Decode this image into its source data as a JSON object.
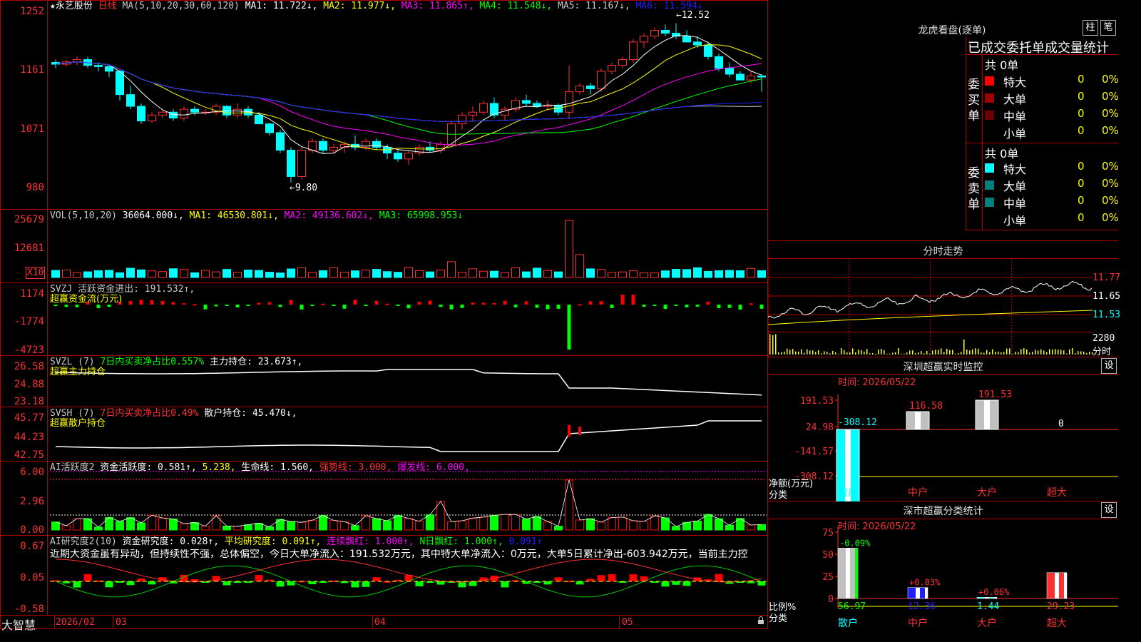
{
  "stock": {
    "star": "★",
    "name": "永艺股份",
    "period": "日线"
  },
  "ma_header": [
    {
      "text": "MA(5,10,20,30,60,120)",
      "color": "#c8c8c8"
    },
    {
      "text": "MA1: 11.722↓,",
      "color": "#ffffff"
    },
    {
      "text": "MA2: 11.977↓,",
      "color": "#ffff00"
    },
    {
      "text": "MA3: 11.865↑,",
      "color": "#ff00ff"
    },
    {
      "text": "MA4: 11.548↓,",
      "color": "#00ff00"
    },
    {
      "text": "MA5: 11.167↓,",
      "color": "#c8c8c8"
    },
    {
      "text": "MA6: 11.594↓",
      "color": "#2020ff"
    }
  ],
  "price_axis": [
    "1252",
    "1161",
    "1071",
    "980"
  ],
  "price_marks": {
    "high": "12.52",
    "low": "9.80"
  },
  "vol_header": [
    {
      "text": "VOL(5,10,20)",
      "color": "#c8c8c8"
    },
    {
      "text": "36064.000↓,",
      "color": "#ffffff"
    },
    {
      "text": "MA1: 46530.801↓,",
      "color": "#ffff00"
    },
    {
      "text": "MA2: 49136.602↓,",
      "color": "#ff00ff"
    },
    {
      "text": "MA3: 65998.953↓",
      "color": "#00ff00"
    }
  ],
  "vol_axis": [
    "25679",
    "12681"
  ],
  "vol_unit": "X10",
  "svzj": {
    "line1": [
      {
        "text": "SVZJ  活跃资金进出: 191.532↑,",
        "color": "#c8c8c8"
      }
    ],
    "line2": "超赢资金流(万元)",
    "axis": [
      "1174",
      "-1774",
      "-4723"
    ]
  },
  "svzl": {
    "line1": [
      {
        "text": "SVZL (7)",
        "color": "#c8c8c8"
      },
      {
        "text": "7日内买卖净占比0.557%",
        "color": "#00ff00"
      },
      {
        "text": "主力持仓: 23.673↑,",
        "color": "#ffffff"
      }
    ],
    "line2": "超赢主力持仓",
    "axis": [
      "26.58",
      "24.88",
      "23.18"
    ]
  },
  "svsh": {
    "line1": [
      {
        "text": "SVSH (7)",
        "color": "#c8c8c8"
      },
      {
        "text": "7日内买卖净占比0.49%",
        "color": "#ff3030"
      },
      {
        "text": "散户持仓: 45.470↓,",
        "color": "#ffffff"
      }
    ],
    "line2": "超赢散户持仓",
    "axis": [
      "45.77",
      "44.23",
      "42.75"
    ]
  },
  "ai_active": {
    "line1": [
      {
        "text": "AI活跃度2",
        "color": "#c8c8c8"
      },
      {
        "text": "资金活跃度: 0.581↑,",
        "color": "#ffffff"
      },
      {
        "text": "5.238,",
        "color": "#ffff00"
      },
      {
        "text": "生命线: 1.560,",
        "color": "#ffffff"
      },
      {
        "text": "强势线: 3.000,",
        "color": "#ff3030"
      },
      {
        "text": "爆发线: 6.000,",
        "color": "#ff00ff"
      }
    ],
    "axis": [
      "6.00",
      "2.96",
      "0.00"
    ]
  },
  "ai_research": {
    "line1": [
      {
        "text": "AI研究度2(10)",
        "color": "#c8c8c8"
      },
      {
        "text": "资金研究度: 0.028↑,",
        "color": "#ffffff"
      },
      {
        "text": "平均研究度: 0.091↑,",
        "color": "#ffff00"
      },
      {
        "text": "连续飘红: 1.000↑,",
        "color": "#ff00ff"
      },
      {
        "text": "N日飘红: 1.000↑,",
        "color": "#00ff00"
      },
      {
        "text": "0.091↑",
        "color": "#2020ff"
      }
    ],
    "summary": "近期大资金虽有异动，但持续性不强，总体偏空，今日大单净流入：191.532万元，其中特大单净流入：0万元，大单5日累计净出-603.942万元，当前主力控",
    "axis": [
      "0.67",
      "0.05",
      "-0.58"
    ]
  },
  "bottom": {
    "brand": "大智慧",
    "dates": [
      "2026/02",
      "03",
      "04",
      "05"
    ]
  },
  "colors": {
    "up": "#ff3030",
    "down": "#00ffff",
    "red": "#ff0000",
    "green": "#00ff00",
    "frame": "#b00000"
  },
  "right": {
    "lhb_title": "龙虎看盘(逐单)",
    "btn_bar": "柱",
    "btn_pen": "笔",
    "stat_title": "已成交委托单成交量统计",
    "buy_label": "委买单",
    "sell_label": "委卖单",
    "buy_total": "共 0单",
    "sell_total": "共 0单",
    "buy_rows": [
      {
        "label": "特大",
        "qty": "0",
        "pct": "0%",
        "color": "#ff0000"
      },
      {
        "label": "大单",
        "qty": "0",
        "pct": "0%",
        "color": "#a00000"
      },
      {
        "label": "中单",
        "qty": "0",
        "pct": "0%",
        "color": "#700000"
      },
      {
        "label": "小单",
        "qty": "0",
        "pct": "0%",
        "color": "#000000"
      }
    ],
    "sell_rows": [
      {
        "label": "特大",
        "qty": "0",
        "pct": "0%",
        "color": "#00ffff"
      },
      {
        "label": "大单",
        "qty": "0",
        "pct": "0%",
        "color": "#008080"
      },
      {
        "label": "中单",
        "qty": "0",
        "pct": "0%",
        "color": "#008080"
      },
      {
        "label": "小单",
        "qty": "0",
        "pct": "0%",
        "color": "#000000"
      }
    ],
    "fenshi_title": "分时走势",
    "fenshi_axis": [
      "11.77",
      "11.65",
      "11.53"
    ],
    "fenshi_vol_label": "2280",
    "fenshi_vol_unit": "分时",
    "sz_monitor_title": "深圳超赢实时监控",
    "sz_monitor_btn": "设",
    "sz_monitor_time": "时间: 2026/05/22",
    "monitor_axis": [
      "191.53",
      "24.98",
      "-141.57",
      "-308.12"
    ],
    "monitor_ylabel": "净额(万元)",
    "monitor_xlabel": "分类",
    "monitor_cats": [
      "散户",
      "中户",
      "大户",
      "超大"
    ],
    "monitor_values": [
      "-308.12",
      "116.58",
      "191.53",
      "0"
    ],
    "sz_class_title": "深市超赢分类统计",
    "sz_class_btn": "设",
    "sz_class_time": "时间: 2026/05/22",
    "class_axis": [
      "75",
      "50",
      "25",
      "0"
    ],
    "class_ylabel": "比例%",
    "class_xlabel": "分类",
    "class_cats": [
      "散户",
      "中户",
      "大户",
      "超大"
    ],
    "class_deltas": [
      "-0.09%",
      "+0.03%",
      "+0.06%"
    ],
    "class_values": [
      "56.97",
      "12.36",
      "1.44",
      "29.23"
    ]
  },
  "chart_data": [
    {
      "type": "candlestick",
      "title": "永艺股份 日线",
      "ylim": [
        9.6,
        12.65
      ],
      "x": [
        "2026/02",
        "03",
        "04",
        "05"
      ],
      "ohlc": [
        [
          11.85,
          11.9,
          11.75,
          11.82
        ],
        [
          11.82,
          11.9,
          11.78,
          11.86
        ],
        [
          11.86,
          11.95,
          11.8,
          11.9
        ],
        [
          11.9,
          11.95,
          11.76,
          11.8
        ],
        [
          11.8,
          11.85,
          11.7,
          11.78
        ],
        [
          11.78,
          11.8,
          11.6,
          11.7
        ],
        [
          11.7,
          11.72,
          11.2,
          11.3
        ],
        [
          11.3,
          11.45,
          11.05,
          11.1
        ],
        [
          11.1,
          11.15,
          10.8,
          10.85
        ],
        [
          10.85,
          11.0,
          10.82,
          10.95
        ],
        [
          10.95,
          11.05,
          10.9,
          11.0
        ],
        [
          11.0,
          11.05,
          10.85,
          10.9
        ],
        [
          10.9,
          11.1,
          10.85,
          11.05
        ],
        [
          11.05,
          11.1,
          10.95,
          11.0
        ],
        [
          11.0,
          11.05,
          10.95,
          11.0
        ],
        [
          11.0,
          11.15,
          10.95,
          11.1
        ],
        [
          11.1,
          11.12,
          10.9,
          10.95
        ],
        [
          10.95,
          11.15,
          10.9,
          11.05
        ],
        [
          11.05,
          11.1,
          10.9,
          10.95
        ],
        [
          10.95,
          11.0,
          10.8,
          10.8
        ],
        [
          10.8,
          10.82,
          10.6,
          10.65
        ],
        [
          10.65,
          10.7,
          10.3,
          10.35
        ],
        [
          10.35,
          10.4,
          9.8,
          9.9
        ],
        [
          9.9,
          10.4,
          9.85,
          10.35
        ],
        [
          10.35,
          10.55,
          10.3,
          10.5
        ],
        [
          10.5,
          10.55,
          10.3,
          10.35
        ],
        [
          10.35,
          10.45,
          10.3,
          10.4
        ],
        [
          10.4,
          10.5,
          10.3,
          10.45
        ],
        [
          10.45,
          10.6,
          10.35,
          10.4
        ],
        [
          10.4,
          10.55,
          10.35,
          10.5
        ],
        [
          10.5,
          10.55,
          10.35,
          10.4
        ],
        [
          10.4,
          10.45,
          10.2,
          10.3
        ],
        [
          10.3,
          10.35,
          10.15,
          10.2
        ],
        [
          10.2,
          10.35,
          10.1,
          10.3
        ],
        [
          10.3,
          10.45,
          10.25,
          10.4
        ],
        [
          10.4,
          10.5,
          10.32,
          10.35
        ],
        [
          10.35,
          10.5,
          10.3,
          10.45
        ],
        [
          10.45,
          10.85,
          10.4,
          10.8
        ],
        [
          10.8,
          11.0,
          10.7,
          10.95
        ],
        [
          10.95,
          11.1,
          10.85,
          11.0
        ],
        [
          11.0,
          11.2,
          10.95,
          11.15
        ],
        [
          11.15,
          11.25,
          10.9,
          10.95
        ],
        [
          10.95,
          11.1,
          10.85,
          11.05
        ],
        [
          11.05,
          11.25,
          11.0,
          11.2
        ],
        [
          11.2,
          11.3,
          11.1,
          11.15
        ],
        [
          11.15,
          11.2,
          11.08,
          11.1
        ],
        [
          11.1,
          11.2,
          11.05,
          11.12
        ],
        [
          11.12,
          11.15,
          10.95,
          11.0
        ],
        [
          11.0,
          11.8,
          10.9,
          11.35
        ],
        [
          11.35,
          11.5,
          11.3,
          11.45
        ],
        [
          11.45,
          11.5,
          11.3,
          11.4
        ],
        [
          11.4,
          11.75,
          11.35,
          11.7
        ],
        [
          11.7,
          11.85,
          11.65,
          11.8
        ],
        [
          11.8,
          11.95,
          11.75,
          11.9
        ],
        [
          11.9,
          12.25,
          11.85,
          12.2
        ],
        [
          12.2,
          12.35,
          12.1,
          12.3
        ],
        [
          12.3,
          12.45,
          12.25,
          12.4
        ],
        [
          12.4,
          12.5,
          12.3,
          12.35
        ],
        [
          12.35,
          12.52,
          12.25,
          12.3
        ],
        [
          12.3,
          12.4,
          12.2,
          12.2
        ],
        [
          12.2,
          12.3,
          12.1,
          12.15
        ],
        [
          12.15,
          12.2,
          11.9,
          11.95
        ],
        [
          11.95,
          12.0,
          11.7,
          11.75
        ],
        [
          11.75,
          11.85,
          11.6,
          11.65
        ],
        [
          11.65,
          11.7,
          11.55,
          11.55
        ],
        [
          11.55,
          11.7,
          11.5,
          11.62
        ],
        [
          11.62,
          11.65,
          11.35,
          11.6
        ]
      ]
    }
  ]
}
